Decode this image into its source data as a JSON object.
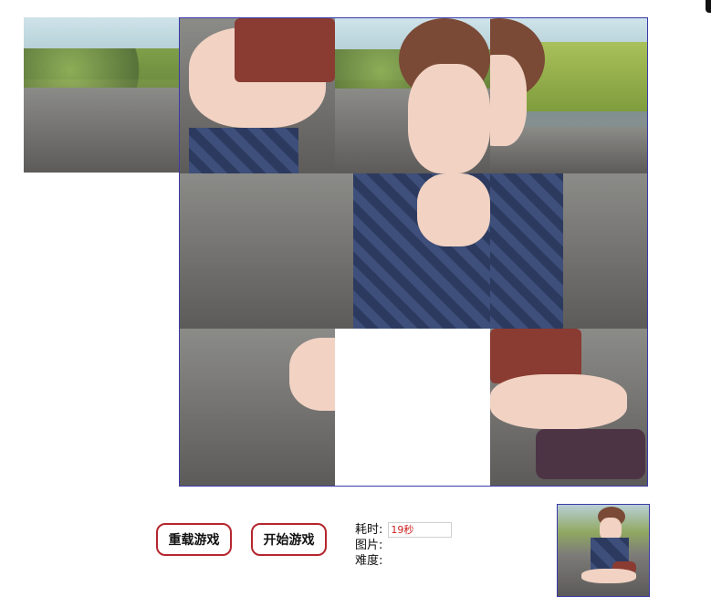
{
  "controls": {
    "reload_label": "重载游戏",
    "start_label": "开始游戏"
  },
  "info": {
    "time_label": "耗时:",
    "time_value": "19秒",
    "image_label": "图片:",
    "difficulty_label": "难度:"
  },
  "colors": {
    "accent": "#b5262e",
    "board_border": "#3a3aa8",
    "time_text": "#cc1f1f"
  },
  "icons": [
    "puzzle-tile",
    "reference-thumbnail"
  ]
}
